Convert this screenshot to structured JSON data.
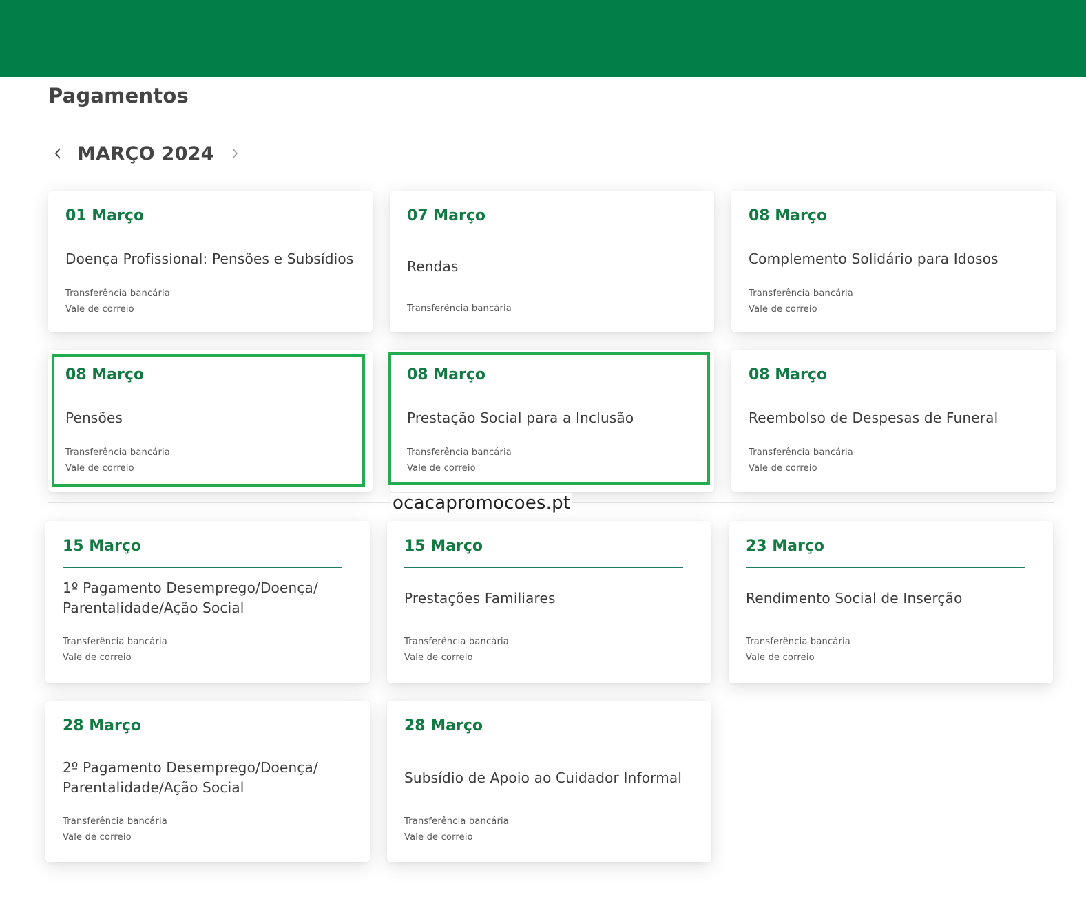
{
  "page": {
    "title": "Pagamentos",
    "month": "MARÇO 2024",
    "prev_icon": "chevron-left-icon",
    "next_icon": "chevron-right-icon"
  },
  "colors": {
    "header": "#008048",
    "date": "#147a44",
    "highlight": "#23ab4f"
  },
  "watermark": "ocacapromocoes.pt",
  "cards": [
    {
      "date": "01 Março",
      "title": "Doença Profissional: Pensões e Subsídios",
      "methods": [
        "Transferência bancária",
        "Vale de correio"
      ]
    },
    {
      "date": "07 Março",
      "title": "Rendas",
      "methods": [
        "Transferência bancária"
      ]
    },
    {
      "date": "08 Março",
      "title": "Complemento Solidário para Idosos",
      "methods": [
        "Transferência bancária",
        "Vale de correio"
      ]
    },
    {
      "date": "08 Março",
      "title": "Pensões",
      "methods": [
        "Transferência bancária",
        "Vale de correio"
      ],
      "highlighted": true
    },
    {
      "date": "08 Março",
      "title": "Prestação Social para a Inclusão",
      "methods": [
        "Transferência bancária",
        "Vale de correio"
      ],
      "highlighted": true
    },
    {
      "date": "08 Março",
      "title": "Reembolso de Despesas de Funeral",
      "methods": [
        "Transferência bancária",
        "Vale de correio"
      ]
    },
    {
      "date": "15 Março",
      "title": "1º Pagamento Desemprego/Doença/ Parentalidade/Ação Social",
      "methods": [
        "Transferência bancária",
        "Vale de correio"
      ]
    },
    {
      "date": "15 Março",
      "title": "Prestações Familiares",
      "methods": [
        "Transferência bancária",
        "Vale de correio"
      ]
    },
    {
      "date": "23 Março",
      "title": "Rendimento Social de Inserção",
      "methods": [
        "Transferência bancária",
        "Vale de correio"
      ]
    },
    {
      "date": "28 Março",
      "title": "2º Pagamento Desemprego/Doença/ Parentalidade/Ação Social",
      "methods": [
        "Transferência bancária",
        "Vale de correio"
      ]
    },
    {
      "date": "28 Março",
      "title": "Subsídio de Apoio ao Cuidador Informal",
      "methods": [
        "Transferência bancária",
        "Vale de correio"
      ]
    }
  ]
}
